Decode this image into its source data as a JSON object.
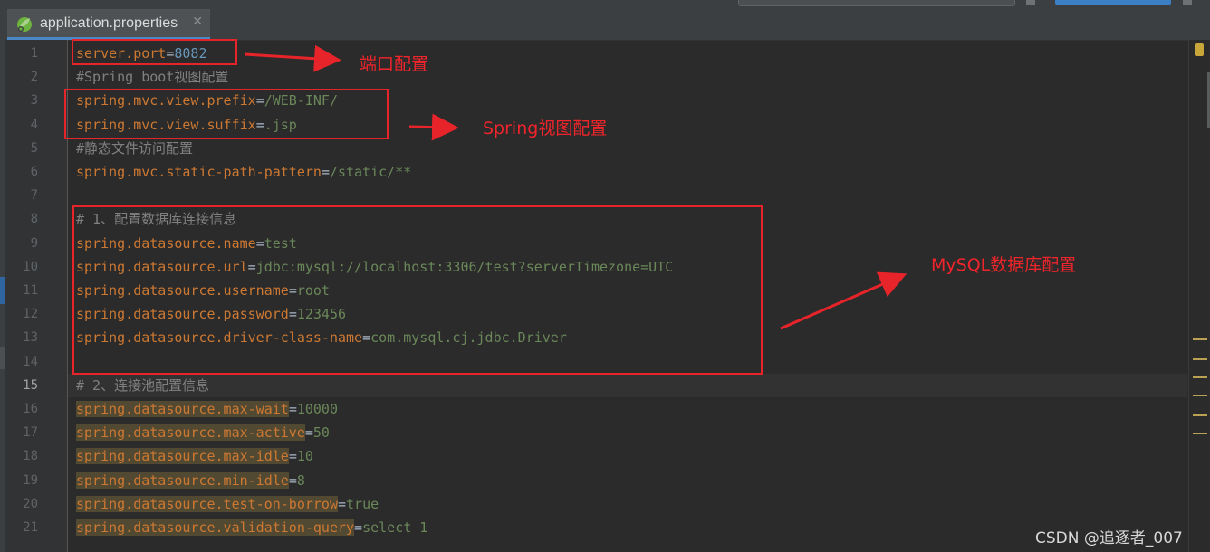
{
  "tab": {
    "title": "application.properties",
    "close": "✕",
    "icon": "spring-leaf-icon"
  },
  "editor": {
    "current_line": 15,
    "lines": [
      {
        "no": "1",
        "parts": [
          {
            "t": "server.port",
            "c": "key"
          },
          {
            "t": "=",
            "c": "eq"
          },
          {
            "t": "8082",
            "c": "num"
          }
        ]
      },
      {
        "no": "2",
        "parts": [
          {
            "t": "#Spring boot视图配置",
            "c": "cmt"
          }
        ]
      },
      {
        "no": "3",
        "parts": [
          {
            "t": "spring.mvc.view.prefix",
            "c": "key"
          },
          {
            "t": "=",
            "c": "eq"
          },
          {
            "t": "/WEB-INF/",
            "c": "val"
          }
        ]
      },
      {
        "no": "4",
        "parts": [
          {
            "t": "spring.mvc.view.suffix",
            "c": "key"
          },
          {
            "t": "=",
            "c": "eq"
          },
          {
            "t": ".jsp",
            "c": "val"
          }
        ]
      },
      {
        "no": "5",
        "parts": [
          {
            "t": "#静态文件访问配置",
            "c": "cmt"
          }
        ]
      },
      {
        "no": "6",
        "parts": [
          {
            "t": "spring.mvc.static-path-pattern",
            "c": "key"
          },
          {
            "t": "=",
            "c": "eq"
          },
          {
            "t": "/static/**",
            "c": "val"
          }
        ]
      },
      {
        "no": "7",
        "parts": []
      },
      {
        "no": "8",
        "parts": [
          {
            "t": "# 1、配置数据库连接信息",
            "c": "cmt"
          }
        ]
      },
      {
        "no": "9",
        "parts": [
          {
            "t": "spring.datasource.name",
            "c": "key"
          },
          {
            "t": "=",
            "c": "eq"
          },
          {
            "t": "test",
            "c": "val"
          }
        ]
      },
      {
        "no": "10",
        "parts": [
          {
            "t": "spring.datasource.url",
            "c": "key"
          },
          {
            "t": "=",
            "c": "eq"
          },
          {
            "t": "jdbc:mysql://localhost:3306/test?serverTimezone=UTC",
            "c": "val"
          }
        ]
      },
      {
        "no": "11",
        "parts": [
          {
            "t": "spring.datasource.username",
            "c": "key"
          },
          {
            "t": "=",
            "c": "eq"
          },
          {
            "t": "root",
            "c": "val"
          }
        ]
      },
      {
        "no": "12",
        "parts": [
          {
            "t": "spring.datasource.password",
            "c": "key"
          },
          {
            "t": "=",
            "c": "eq"
          },
          {
            "t": "123456",
            "c": "val"
          }
        ]
      },
      {
        "no": "13",
        "parts": [
          {
            "t": "spring.datasource.driver-class-name",
            "c": "key"
          },
          {
            "t": "=",
            "c": "eq"
          },
          {
            "t": "com.mysql.cj.jdbc.Driver",
            "c": "val"
          }
        ]
      },
      {
        "no": "14",
        "parts": []
      },
      {
        "no": "15",
        "parts": [
          {
            "t": "# 2、连接池配置信息",
            "c": "cmt"
          }
        ]
      },
      {
        "no": "16",
        "parts": [
          {
            "t": "spring.datasource.max-wait",
            "c": "key hl"
          },
          {
            "t": "=",
            "c": "eq"
          },
          {
            "t": "10000",
            "c": "val"
          }
        ]
      },
      {
        "no": "17",
        "parts": [
          {
            "t": "spring.datasource.max-active",
            "c": "key hl"
          },
          {
            "t": "=",
            "c": "eq"
          },
          {
            "t": "50",
            "c": "val"
          }
        ]
      },
      {
        "no": "18",
        "parts": [
          {
            "t": "spring.datasource.max-idle",
            "c": "key hl"
          },
          {
            "t": "=",
            "c": "eq"
          },
          {
            "t": "10",
            "c": "val"
          }
        ]
      },
      {
        "no": "19",
        "parts": [
          {
            "t": "spring.datasource.min-idle",
            "c": "key hl"
          },
          {
            "t": "=",
            "c": "eq"
          },
          {
            "t": "8",
            "c": "val"
          }
        ]
      },
      {
        "no": "20",
        "parts": [
          {
            "t": "spring.datasource.test-on-borrow",
            "c": "key hl"
          },
          {
            "t": "=",
            "c": "eq"
          },
          {
            "t": "true",
            "c": "val"
          }
        ]
      },
      {
        "no": "21",
        "parts": [
          {
            "t": "spring.datasource.validation-query",
            "c": "key hl"
          },
          {
            "t": "=",
            "c": "eq"
          },
          {
            "t": "select 1",
            "c": "val"
          }
        ]
      }
    ]
  },
  "annotations": {
    "port": "端口配置",
    "view": "Spring视图配置",
    "mysql": "MySQL数据库配置"
  },
  "watermark": "CSDN @追逐者_007",
  "colors": {
    "annotation": "#e8242b",
    "key": "#cc7832",
    "value": "#6a8759",
    "number": "#6897bb",
    "comment": "#808080"
  }
}
